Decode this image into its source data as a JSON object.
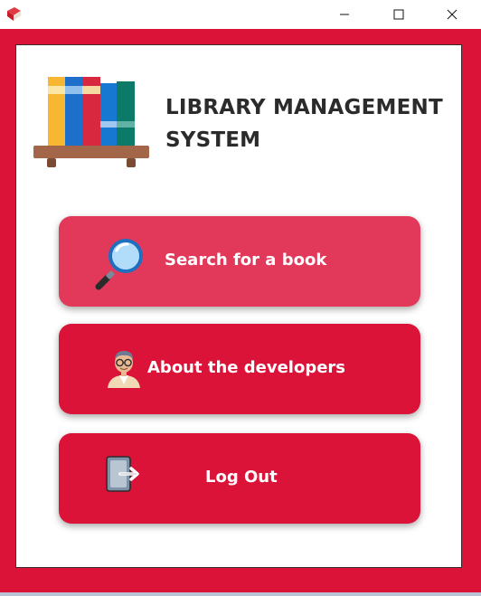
{
  "window": {
    "app_icon": "book-icon",
    "controls": [
      "minimize-icon",
      "maximize-icon",
      "close-icon"
    ]
  },
  "header": {
    "title_line1": "LIBRARY MANAGEMENT",
    "title_line2": "SYSTEM",
    "illustration": "bookshelf-icon"
  },
  "menu": {
    "search": {
      "label": "Search for a book",
      "icon": "magnifier-icon"
    },
    "about": {
      "label": "About the developers",
      "icon": "developer-avatar-icon"
    },
    "logout": {
      "label": "Log Out",
      "icon": "logout-icon"
    }
  },
  "colors": {
    "frame": "#dc1339",
    "button": "#dc1339",
    "button_highlight": "#e2395a",
    "title_text": "#2b2b2b",
    "button_text": "#ffffff"
  }
}
